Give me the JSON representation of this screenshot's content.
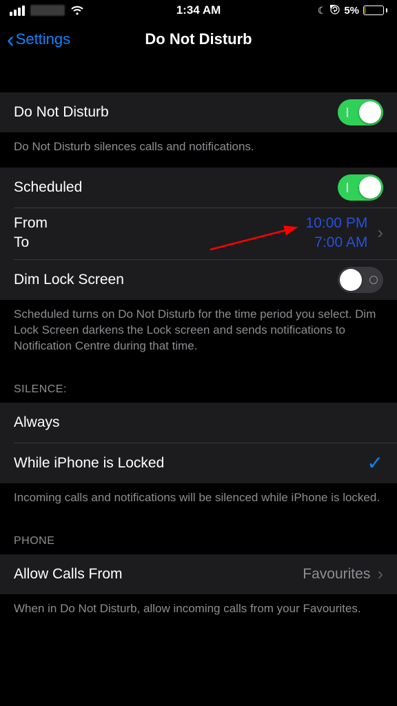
{
  "status": {
    "time": "1:34 AM",
    "battery_pct": "5%"
  },
  "nav": {
    "back_label": "Settings",
    "title": "Do Not Disturb"
  },
  "dnd": {
    "label": "Do Not Disturb",
    "footer": "Do Not Disturb silences calls and notifications."
  },
  "scheduled": {
    "label": "Scheduled",
    "from_label": "From",
    "to_label": "To",
    "from_value": "10:00 PM",
    "to_value": "7:00 AM",
    "dim_label": "Dim Lock Screen",
    "footer": "Scheduled turns on Do Not Disturb for the time period you select. Dim Lock Screen darkens the Lock screen and sends notifications to Notification Centre during that time."
  },
  "silence": {
    "header": "SILENCE:",
    "always": "Always",
    "while_locked": "While iPhone is Locked",
    "footer": "Incoming calls and notifications will be silenced while iPhone is locked."
  },
  "phone": {
    "header": "PHONE",
    "allow_label": "Allow Calls From",
    "allow_value": "Favourites",
    "footer": "When in Do Not Disturb, allow incoming calls from your Favourites."
  }
}
